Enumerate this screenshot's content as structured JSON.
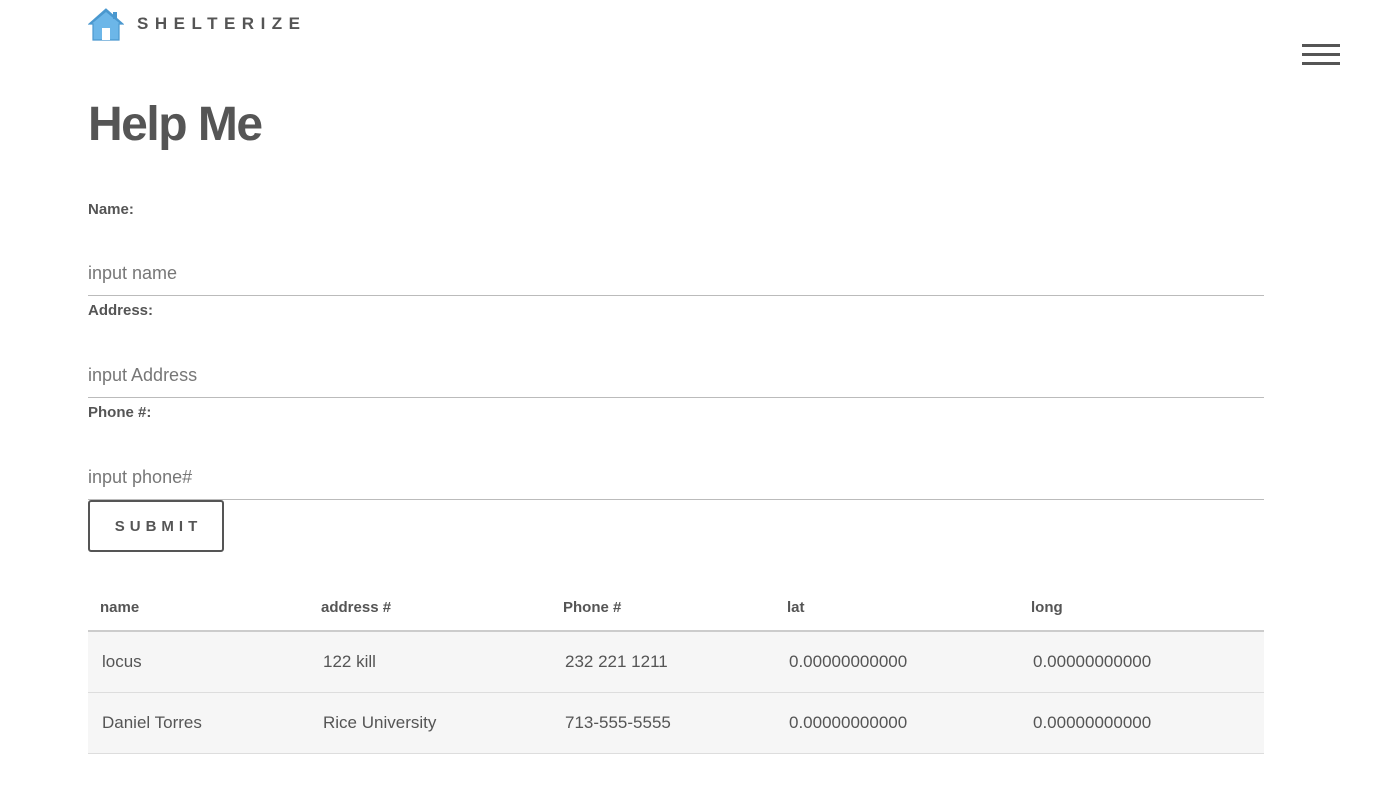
{
  "brand": {
    "name": "SHELTERIZE",
    "logo_icon": "house-icon",
    "logo_color": "#6cb6e8"
  },
  "menu": {
    "icon": "hamburger-menu-icon"
  },
  "page": {
    "title": "Help Me"
  },
  "form": {
    "name_label": "Name:",
    "name_placeholder": "input name",
    "address_label": "Address:",
    "address_placeholder": "input Address",
    "phone_label": "Phone #:",
    "phone_placeholder": "input phone#",
    "submit_label": "SUBMIT"
  },
  "table": {
    "headers": [
      "name",
      "address #",
      "Phone #",
      "lat",
      "long"
    ],
    "rows": [
      [
        "locus",
        "122 kill",
        "232 221 1211",
        "0.00000000000",
        "0.00000000000"
      ],
      [
        "Daniel Torres",
        "Rice University",
        "713-555-5555",
        "0.00000000000",
        "0.00000000000"
      ]
    ]
  }
}
